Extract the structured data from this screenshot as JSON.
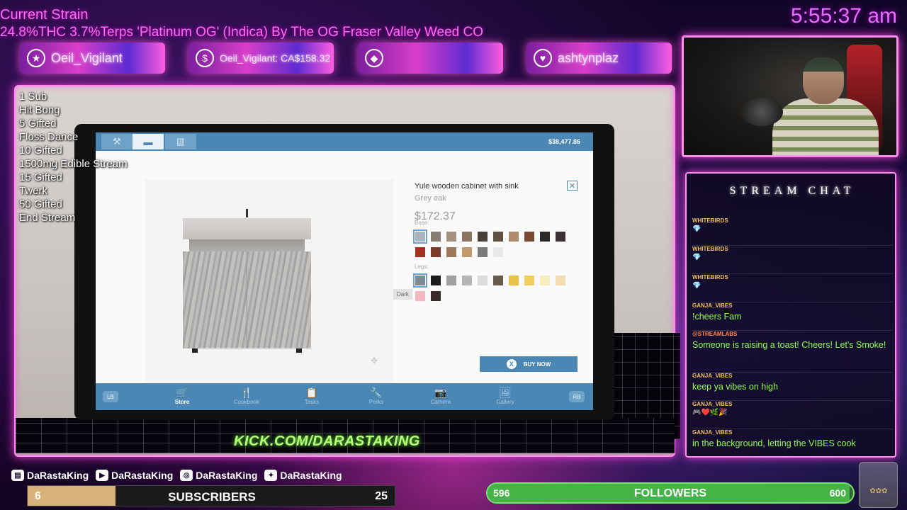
{
  "stream": {
    "strain_title": "Current Strain",
    "strain_desc": "24.8%THC 3.7%Terps 'Platinum OG' (Indica) By The OG Fraser Valley Weed CO",
    "clock": "5:55:37 am",
    "banners": [
      {
        "icon": "star-icon",
        "text": "Oeil_Vigilant"
      },
      {
        "icon": "dollar-icon",
        "text": "Oeil_Vigilant: CA$158.32"
      },
      {
        "icon": "diamond-icon",
        "text": ""
      },
      {
        "icon": "heart-icon",
        "text": "ashtynplaz"
      }
    ],
    "goals": [
      "1 Sub",
      "Hit Bong",
      "5 Gifted",
      "Floss Dance",
      "10 Gifted",
      "1500mg Edible Stream",
      "15 Gifted",
      "Twerk",
      "50 Gifted",
      "End Stream"
    ],
    "kick_link": "KICK.COM/DARASTAKING"
  },
  "game": {
    "money": "$38,477.86",
    "product_name": "Yule wooden cabinet with sink",
    "variant": "Grey oak",
    "price": "$172.37",
    "base_label": "Base:",
    "legs_label": "Legs:",
    "tooltip": "Dark",
    "buy_label": "BUY NOW",
    "buy_key": "X",
    "base_colors": [
      "#a8b4bf",
      "#857d72",
      "#a2927f",
      "#8a7464",
      "#4a3f37",
      "#5f5140",
      "#b08b6c",
      "#7a4b32",
      "#2c2a28",
      "#3d3030",
      "#a33020",
      "#7a3a2a",
      "#9a7a5a",
      "#c09a6a",
      "#7a7a7a",
      "#e8e8e8"
    ],
    "legs_colors": [
      "#7f8a93",
      "#1a1a1a",
      "#a0a0a0",
      "#b5b5b5",
      "#dcdcdc",
      "#6a5a4a",
      "#e9c04a",
      "#f2d060",
      "#f7ecc0",
      "#f2ddb0",
      "#f2b8c0",
      "#3a2a2a"
    ],
    "nav": [
      {
        "label": "Store",
        "icon": "cart-icon",
        "glyph": "🛒"
      },
      {
        "label": "Cookbook",
        "icon": "utensils-icon",
        "glyph": "🍴"
      },
      {
        "label": "Tasks",
        "icon": "clipboard-icon",
        "glyph": "📋"
      },
      {
        "label": "Perks",
        "icon": "wrench-icon",
        "glyph": "🔧"
      },
      {
        "label": "Camera",
        "icon": "camera-icon",
        "glyph": "📷"
      },
      {
        "label": "Gallery",
        "icon": "image-icon",
        "glyph": "🖼"
      }
    ],
    "lb": "LB",
    "rb": "RB"
  },
  "chat": {
    "title": "STREAM CHAT",
    "messages": [
      {
        "user": "WHITEBIRDS",
        "text": "",
        "emote": "💎"
      },
      {
        "user": "WHITEBIRDS",
        "text": "",
        "emote": "💎"
      },
      {
        "user": "WHITEBIRDS",
        "text": "",
        "emote": "💎"
      },
      {
        "user": "GANJA_VIBES",
        "text": "!cheers Fam",
        "emote": ""
      },
      {
        "user": "@STREAMLABS",
        "text": "Someone is raising a toast! Cheers! Let's Smoke!",
        "emote": ""
      },
      {
        "user": "GANJA_VIBES",
        "text": "keep ya vibes on high",
        "emote": ""
      },
      {
        "user": "GANJA_VIBES",
        "text": "",
        "emote": "🎮❤️🌿🎉"
      },
      {
        "user": "GANJA_VIBES",
        "text": "in the background, letting the VIBES cook",
        "emote": ""
      }
    ]
  },
  "bottom": {
    "socials": [
      "DaRastaKing",
      "DaRastaKing",
      "DaRastaKing",
      "DaRastaKing"
    ],
    "subs": {
      "label": "SUBSCRIBERS",
      "current": "6",
      "goal": "25",
      "fraction": 0.24
    },
    "followers": {
      "label": "FOLLOWERS",
      "current": "596",
      "goal": "600",
      "fraction": 0.99
    }
  }
}
